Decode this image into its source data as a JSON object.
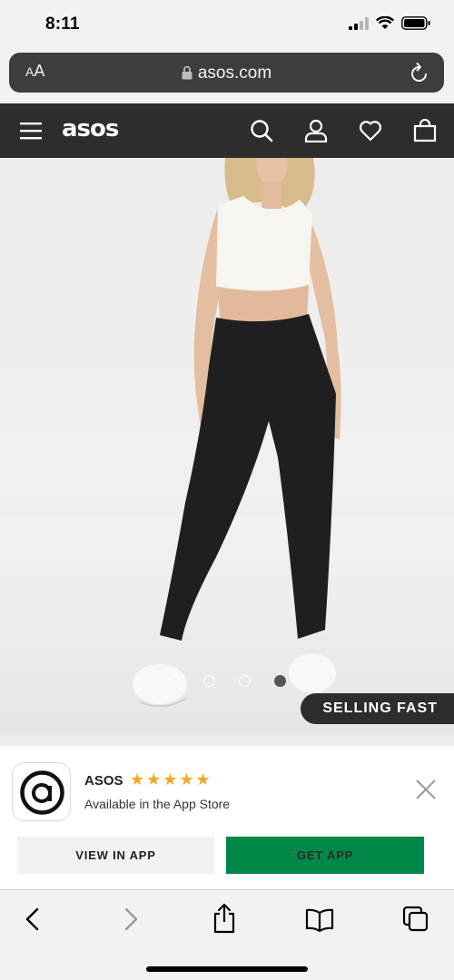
{
  "status_bar": {
    "time": "8:11"
  },
  "browser": {
    "aa_label_small": "A",
    "aa_label_large": "A",
    "url": "asos.com"
  },
  "header": {
    "logo": "asos",
    "icons": [
      "menu-icon",
      "search-icon",
      "account-icon",
      "heart-icon",
      "bag-icon"
    ]
  },
  "product": {
    "carousel": {
      "total": 4,
      "active_index": 4
    },
    "badge": "SELLING FAST"
  },
  "app_banner": {
    "name": "ASOS",
    "rating": "★★★★★",
    "subtitle": "Available in the App Store",
    "view_button": "VIEW IN APP",
    "get_button": "GET APP",
    "get_button_color": "#018849"
  },
  "toolbar": {
    "icons": [
      "back-icon",
      "forward-icon",
      "share-icon",
      "bookmarks-icon",
      "tabs-icon"
    ]
  }
}
